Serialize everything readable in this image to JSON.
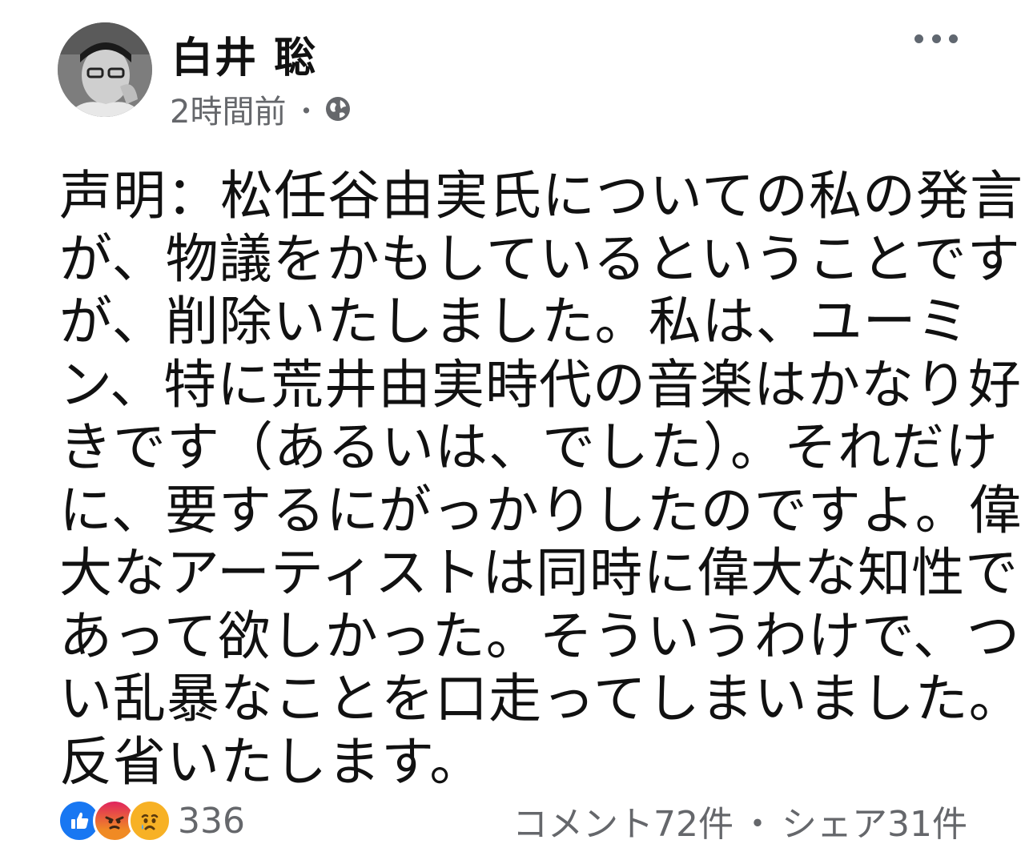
{
  "author": {
    "name": "白井 聡"
  },
  "post": {
    "timestamp": "2時間前",
    "separator": "・",
    "privacy_icon": "globe-icon",
    "more_icon": "more-options-icon",
    "text_lines": [
      "声明：松任谷由実氏についての私の発言",
      "が、物議をかもしているということです",
      "が、削除いたしました。私は、ユーミ",
      "ン、特に荒井由実時代の音楽はかなり好",
      "きです（あるいは、でした）。それだけ",
      "に、要するにがっかりしたのですよ。偉",
      "大なアーティストは同時に偉大な知性で",
      "あって欲しかった。そういうわけで、つ",
      "い乱暴なことを口走ってしまいました。",
      "反省いたします。"
    ]
  },
  "footer": {
    "reaction_icons": [
      "like-icon",
      "angry-icon",
      "sad-icon"
    ],
    "reaction_count": "336",
    "comments": "コメント72件",
    "separator": "・",
    "shares": "シェア31件"
  },
  "colors": {
    "like": "#1877f2",
    "angry": "#e9710f",
    "sad": "#f7b125",
    "meta_text": "#65676b"
  }
}
